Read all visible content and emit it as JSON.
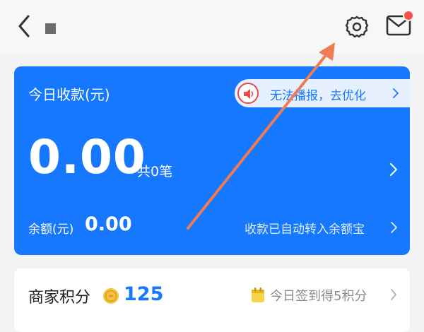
{
  "header": {
    "back_icon": "chevron-left-icon",
    "settings_icon": "gear-icon",
    "mail_icon": "mail-icon",
    "has_unread_dot": true
  },
  "collection_card": {
    "title": "今日收款(元)",
    "notice": {
      "icon": "speaker-icon",
      "text": "无法播报，去优化"
    },
    "amount": "0.00",
    "count": "共0笔",
    "balance_label": "余额(元)",
    "balance_value": "0.00",
    "auto_transfer_text": "收款已自动转入余额宝"
  },
  "points_card": {
    "title": "商家积分",
    "coin_icon": "coin-icon",
    "points": "125",
    "sign_icon": "calendar-icon",
    "sign_text": "今日签到得5积分"
  },
  "colors": {
    "primary": "#1677ff",
    "alert_red": "#e84b4b",
    "annotation_arrow": "#f07b54"
  }
}
